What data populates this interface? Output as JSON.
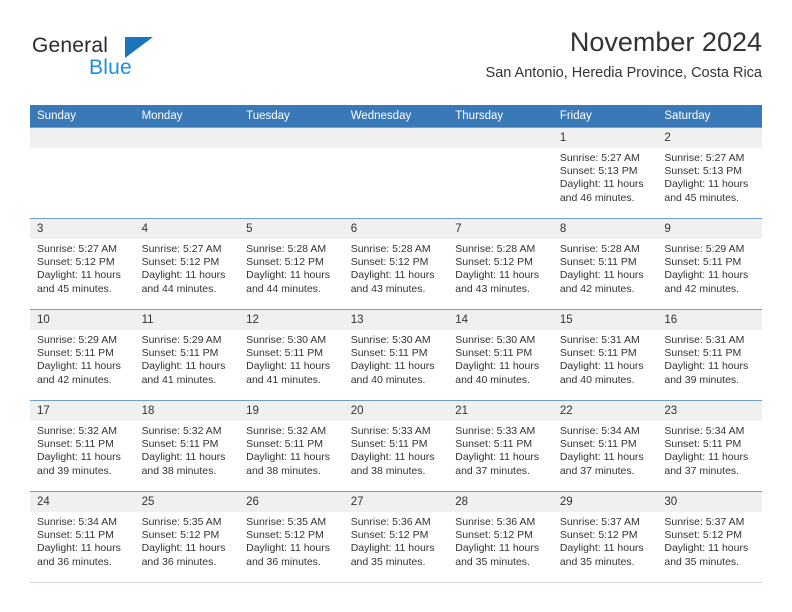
{
  "brand": {
    "name_top": "General",
    "name_bottom": "Blue",
    "triangle_color": "#1b75bb",
    "blue_text_color": "#1b8fe0"
  },
  "header": {
    "title": "November 2024",
    "subtitle": "San Antonio, Heredia Province, Costa Rica"
  },
  "theme": {
    "header_row_bg": "#3a79b8",
    "header_row_text": "#ffffff",
    "daynum_bg": "#f0f0f0",
    "cell_border": "#6f9fcb"
  },
  "weekdays": [
    "Sunday",
    "Monday",
    "Tuesday",
    "Wednesday",
    "Thursday",
    "Friday",
    "Saturday"
  ],
  "labels": {
    "sunrise": "Sunrise:",
    "sunset": "Sunset:",
    "daylight": "Daylight:"
  },
  "weeks": [
    [
      {
        "day": "",
        "sunrise": "",
        "sunset": "",
        "daylight_line1": "",
        "daylight_line2": ""
      },
      {
        "day": "",
        "sunrise": "",
        "sunset": "",
        "daylight_line1": "",
        "daylight_line2": ""
      },
      {
        "day": "",
        "sunrise": "",
        "sunset": "",
        "daylight_line1": "",
        "daylight_line2": ""
      },
      {
        "day": "",
        "sunrise": "",
        "sunset": "",
        "daylight_line1": "",
        "daylight_line2": ""
      },
      {
        "day": "",
        "sunrise": "",
        "sunset": "",
        "daylight_line1": "",
        "daylight_line2": ""
      },
      {
        "day": "1",
        "sunrise": "Sunrise: 5:27 AM",
        "sunset": "Sunset: 5:13 PM",
        "daylight_line1": "Daylight: 11 hours",
        "daylight_line2": "and 46 minutes."
      },
      {
        "day": "2",
        "sunrise": "Sunrise: 5:27 AM",
        "sunset": "Sunset: 5:13 PM",
        "daylight_line1": "Daylight: 11 hours",
        "daylight_line2": "and 45 minutes."
      }
    ],
    [
      {
        "day": "3",
        "sunrise": "Sunrise: 5:27 AM",
        "sunset": "Sunset: 5:12 PM",
        "daylight_line1": "Daylight: 11 hours",
        "daylight_line2": "and 45 minutes."
      },
      {
        "day": "4",
        "sunrise": "Sunrise: 5:27 AM",
        "sunset": "Sunset: 5:12 PM",
        "daylight_line1": "Daylight: 11 hours",
        "daylight_line2": "and 44 minutes."
      },
      {
        "day": "5",
        "sunrise": "Sunrise: 5:28 AM",
        "sunset": "Sunset: 5:12 PM",
        "daylight_line1": "Daylight: 11 hours",
        "daylight_line2": "and 44 minutes."
      },
      {
        "day": "6",
        "sunrise": "Sunrise: 5:28 AM",
        "sunset": "Sunset: 5:12 PM",
        "daylight_line1": "Daylight: 11 hours",
        "daylight_line2": "and 43 minutes."
      },
      {
        "day": "7",
        "sunrise": "Sunrise: 5:28 AM",
        "sunset": "Sunset: 5:12 PM",
        "daylight_line1": "Daylight: 11 hours",
        "daylight_line2": "and 43 minutes."
      },
      {
        "day": "8",
        "sunrise": "Sunrise: 5:28 AM",
        "sunset": "Sunset: 5:11 PM",
        "daylight_line1": "Daylight: 11 hours",
        "daylight_line2": "and 42 minutes."
      },
      {
        "day": "9",
        "sunrise": "Sunrise: 5:29 AM",
        "sunset": "Sunset: 5:11 PM",
        "daylight_line1": "Daylight: 11 hours",
        "daylight_line2": "and 42 minutes."
      }
    ],
    [
      {
        "day": "10",
        "sunrise": "Sunrise: 5:29 AM",
        "sunset": "Sunset: 5:11 PM",
        "daylight_line1": "Daylight: 11 hours",
        "daylight_line2": "and 42 minutes."
      },
      {
        "day": "11",
        "sunrise": "Sunrise: 5:29 AM",
        "sunset": "Sunset: 5:11 PM",
        "daylight_line1": "Daylight: 11 hours",
        "daylight_line2": "and 41 minutes."
      },
      {
        "day": "12",
        "sunrise": "Sunrise: 5:30 AM",
        "sunset": "Sunset: 5:11 PM",
        "daylight_line1": "Daylight: 11 hours",
        "daylight_line2": "and 41 minutes."
      },
      {
        "day": "13",
        "sunrise": "Sunrise: 5:30 AM",
        "sunset": "Sunset: 5:11 PM",
        "daylight_line1": "Daylight: 11 hours",
        "daylight_line2": "and 40 minutes."
      },
      {
        "day": "14",
        "sunrise": "Sunrise: 5:30 AM",
        "sunset": "Sunset: 5:11 PM",
        "daylight_line1": "Daylight: 11 hours",
        "daylight_line2": "and 40 minutes."
      },
      {
        "day": "15",
        "sunrise": "Sunrise: 5:31 AM",
        "sunset": "Sunset: 5:11 PM",
        "daylight_line1": "Daylight: 11 hours",
        "daylight_line2": "and 40 minutes."
      },
      {
        "day": "16",
        "sunrise": "Sunrise: 5:31 AM",
        "sunset": "Sunset: 5:11 PM",
        "daylight_line1": "Daylight: 11 hours",
        "daylight_line2": "and 39 minutes."
      }
    ],
    [
      {
        "day": "17",
        "sunrise": "Sunrise: 5:32 AM",
        "sunset": "Sunset: 5:11 PM",
        "daylight_line1": "Daylight: 11 hours",
        "daylight_line2": "and 39 minutes."
      },
      {
        "day": "18",
        "sunrise": "Sunrise: 5:32 AM",
        "sunset": "Sunset: 5:11 PM",
        "daylight_line1": "Daylight: 11 hours",
        "daylight_line2": "and 38 minutes."
      },
      {
        "day": "19",
        "sunrise": "Sunrise: 5:32 AM",
        "sunset": "Sunset: 5:11 PM",
        "daylight_line1": "Daylight: 11 hours",
        "daylight_line2": "and 38 minutes."
      },
      {
        "day": "20",
        "sunrise": "Sunrise: 5:33 AM",
        "sunset": "Sunset: 5:11 PM",
        "daylight_line1": "Daylight: 11 hours",
        "daylight_line2": "and 38 minutes."
      },
      {
        "day": "21",
        "sunrise": "Sunrise: 5:33 AM",
        "sunset": "Sunset: 5:11 PM",
        "daylight_line1": "Daylight: 11 hours",
        "daylight_line2": "and 37 minutes."
      },
      {
        "day": "22",
        "sunrise": "Sunrise: 5:34 AM",
        "sunset": "Sunset: 5:11 PM",
        "daylight_line1": "Daylight: 11 hours",
        "daylight_line2": "and 37 minutes."
      },
      {
        "day": "23",
        "sunrise": "Sunrise: 5:34 AM",
        "sunset": "Sunset: 5:11 PM",
        "daylight_line1": "Daylight: 11 hours",
        "daylight_line2": "and 37 minutes."
      }
    ],
    [
      {
        "day": "24",
        "sunrise": "Sunrise: 5:34 AM",
        "sunset": "Sunset: 5:11 PM",
        "daylight_line1": "Daylight: 11 hours",
        "daylight_line2": "and 36 minutes."
      },
      {
        "day": "25",
        "sunrise": "Sunrise: 5:35 AM",
        "sunset": "Sunset: 5:12 PM",
        "daylight_line1": "Daylight: 11 hours",
        "daylight_line2": "and 36 minutes."
      },
      {
        "day": "26",
        "sunrise": "Sunrise: 5:35 AM",
        "sunset": "Sunset: 5:12 PM",
        "daylight_line1": "Daylight: 11 hours",
        "daylight_line2": "and 36 minutes."
      },
      {
        "day": "27",
        "sunrise": "Sunrise: 5:36 AM",
        "sunset": "Sunset: 5:12 PM",
        "daylight_line1": "Daylight: 11 hours",
        "daylight_line2": "and 35 minutes."
      },
      {
        "day": "28",
        "sunrise": "Sunrise: 5:36 AM",
        "sunset": "Sunset: 5:12 PM",
        "daylight_line1": "Daylight: 11 hours",
        "daylight_line2": "and 35 minutes."
      },
      {
        "day": "29",
        "sunrise": "Sunrise: 5:37 AM",
        "sunset": "Sunset: 5:12 PM",
        "daylight_line1": "Daylight: 11 hours",
        "daylight_line2": "and 35 minutes."
      },
      {
        "day": "30",
        "sunrise": "Sunrise: 5:37 AM",
        "sunset": "Sunset: 5:12 PM",
        "daylight_line1": "Daylight: 11 hours",
        "daylight_line2": "and 35 minutes."
      }
    ]
  ]
}
